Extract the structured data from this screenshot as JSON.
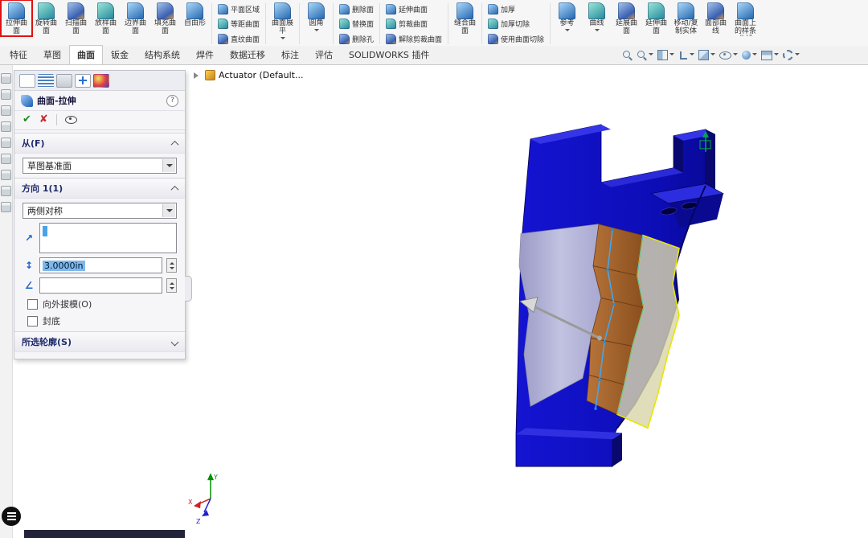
{
  "colors": {
    "highlight_red": "#e01212",
    "model_blue": "#1010c8",
    "model_blue_dark": "#08086e",
    "model_blue_light": "#3535e8",
    "surface_lavender": "#b7b7d6",
    "surface_brown": "#a35f2a",
    "surface_tan": "#d9d5ac",
    "surface_yellow_edge": "#e6e600",
    "sketch_blue": "#3fa9f5"
  },
  "ribbon": {
    "groups": [
      {
        "type": "large",
        "items": [
          {
            "label": "拉伸曲面",
            "icon": "extruded-surface-icon",
            "highlighted": true
          },
          {
            "label": "旋转曲面",
            "icon": "revolved-surface-icon"
          },
          {
            "label": "扫描曲面",
            "icon": "swept-surface-icon"
          },
          {
            "label": "放样曲面",
            "icon": "lofted-surface-icon"
          },
          {
            "label": "边界曲面",
            "icon": "boundary-surface-icon"
          },
          {
            "label": "填充曲面",
            "icon": "filled-surface-icon"
          },
          {
            "label": "自由形",
            "icon": "freeform-icon"
          }
        ]
      },
      {
        "type": "small",
        "items": [
          {
            "label": "平面区域",
            "icon": "planar-surface-icon"
          },
          {
            "label": "等距曲面",
            "icon": "offset-surface-icon"
          },
          {
            "label": "直纹曲面",
            "icon": "ruled-surface-icon"
          }
        ]
      },
      {
        "type": "large",
        "items": [
          {
            "label": "曲面展平",
            "icon": "flatten-surface-icon",
            "caret": true
          }
        ]
      },
      {
        "type": "large",
        "items": [
          {
            "label": "圆角",
            "icon": "fillet-icon",
            "caret": true
          }
        ]
      },
      {
        "type": "small",
        "items": [
          {
            "label": "删除面",
            "icon": "delete-face-icon"
          },
          {
            "label": "替换面",
            "icon": "replace-face-icon"
          },
          {
            "label": "删除孔",
            "icon": "delete-hole-icon"
          }
        ]
      },
      {
        "type": "small",
        "items": [
          {
            "label": "延伸曲面",
            "icon": "extend-surface-icon"
          },
          {
            "label": "剪裁曲面",
            "icon": "trim-surface-icon"
          },
          {
            "label": "解除剪裁曲面",
            "icon": "untrim-surface-icon"
          }
        ]
      },
      {
        "type": "large",
        "items": [
          {
            "label": "缝合曲面",
            "icon": "knit-surface-icon"
          }
        ]
      },
      {
        "type": "small",
        "items": [
          {
            "label": "加厚",
            "icon": "thicken-icon"
          },
          {
            "label": "加厚切除",
            "icon": "thickened-cut-icon"
          },
          {
            "label": "使用曲面切除",
            "icon": "cut-with-surface-icon"
          }
        ]
      },
      {
        "type": "large",
        "items": [
          {
            "label": "参考",
            "icon": "reference-geometry-icon",
            "caret": true
          },
          {
            "label": "曲线",
            "icon": "curves-icon",
            "caret": true
          },
          {
            "label": "延展曲面",
            "icon": "radiate-surface-icon"
          },
          {
            "label": "延伸曲面",
            "icon": "extend-surface-alt-icon"
          },
          {
            "label": "移动/复制实体",
            "icon": "move-copy-body-icon"
          },
          {
            "label": "面部曲线",
            "icon": "face-curves-icon"
          },
          {
            "label": "曲面上的样条曲线",
            "icon": "spline-on-surface-icon"
          }
        ]
      }
    ]
  },
  "tabbar": {
    "tabs": [
      {
        "id": "features",
        "label": "特征"
      },
      {
        "id": "sketch",
        "label": "草图"
      },
      {
        "id": "surfaces",
        "label": "曲面",
        "active": true
      },
      {
        "id": "sheet-metal",
        "label": "钣金"
      },
      {
        "id": "structure-system",
        "label": "结构系统"
      },
      {
        "id": "weldments",
        "label": "焊件"
      },
      {
        "id": "data-migration",
        "label": "数据迁移"
      },
      {
        "id": "annotations",
        "label": "标注"
      },
      {
        "id": "evaluate",
        "label": "评估"
      },
      {
        "id": "solidworks-addins",
        "label": "SOLIDWORKS 插件"
      }
    ],
    "view_icons": [
      {
        "name": "zoom-fit-icon",
        "kind": "mag",
        "caret": false
      },
      {
        "name": "zoom-area-icon",
        "kind": "mag",
        "caret": true
      },
      {
        "name": "section-view-icon",
        "kind": "section",
        "caret": true
      },
      {
        "name": "view-orientation-icon",
        "kind": "axes",
        "caret": true
      },
      {
        "name": "display-style-icon",
        "kind": "cube",
        "caret": true
      },
      {
        "name": "hide-show-items-icon",
        "kind": "eye",
        "caret": true
      },
      {
        "name": "edit-appearance-icon",
        "kind": "ball",
        "caret": true
      },
      {
        "name": "apply-scene-icon",
        "kind": "scene",
        "caret": true
      },
      {
        "name": "view-settings-icon",
        "kind": "gear",
        "caret": true
      }
    ]
  },
  "left_strip": {
    "icons": [
      {
        "name": "side-tool-icon-1"
      },
      {
        "name": "side-tool-icon-2"
      },
      {
        "name": "side-tool-icon-3"
      },
      {
        "name": "side-tool-icon-4"
      },
      {
        "name": "side-tool-icon-5"
      },
      {
        "name": "side-tool-icon-6"
      },
      {
        "name": "side-tool-icon-7"
      },
      {
        "name": "side-tool-icon-8"
      },
      {
        "name": "side-tool-icon-9"
      }
    ]
  },
  "property_manager": {
    "tabs": [
      {
        "name": "pm-tab-properties",
        "active": true
      },
      {
        "name": "pm-tab-feature-tree",
        "active": false
      },
      {
        "name": "pm-tab-page",
        "active": false
      },
      {
        "name": "pm-tab-crosshair",
        "active": false
      },
      {
        "name": "pm-tab-appearance",
        "active": false
      }
    ],
    "title": "曲面-拉伸",
    "help_glyph": "?",
    "ok_glyph": "✔",
    "cancel_glyph": "✘",
    "from_section": {
      "header": "从(F)",
      "plane_value": "草图基准面"
    },
    "direction1_section": {
      "header": "方向 1(1)",
      "end_condition_value": "两侧对称",
      "direction_glyph": "↗",
      "depth_glyph": "↕",
      "draft_glyph": "∠",
      "direction_ref_value": "",
      "depth_value": "3.0000in",
      "draft_value": "",
      "draft_outward_label": "向外拔模(O)",
      "cap_end_label": "封底"
    },
    "selected_contours_section": {
      "header": "所选轮廓(S)"
    }
  },
  "feature_tree": {
    "root_label": "Actuator (Default..."
  },
  "viewport": {
    "triad": {
      "x": "X",
      "y": "Y",
      "z": "Z"
    }
  }
}
